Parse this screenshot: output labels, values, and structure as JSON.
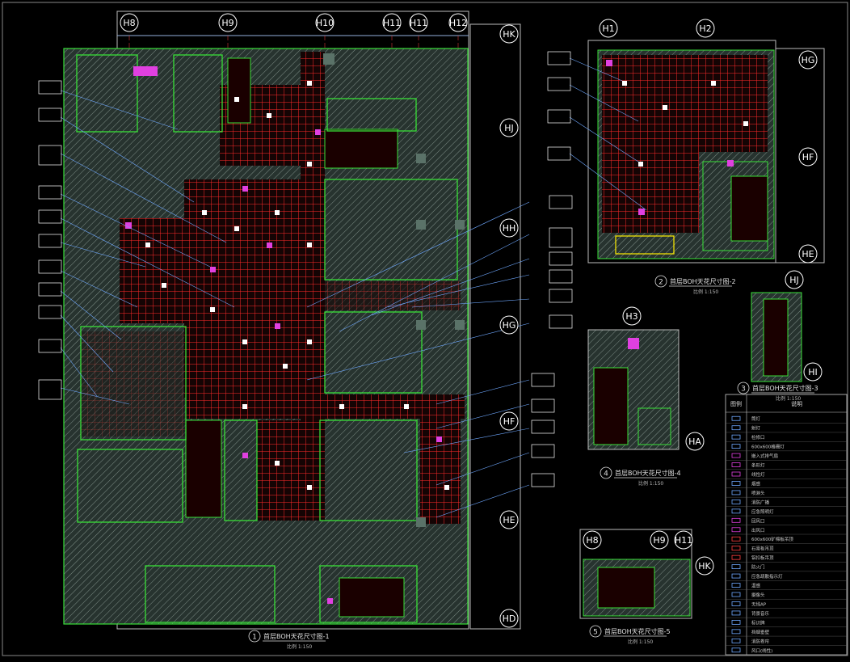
{
  "colors": {
    "background": "#000000",
    "wall_fill": "#3a4a44",
    "hatch": "#7f8f88",
    "ceiling_grid": "#ff2a2a",
    "room_outline": "#38e038",
    "fixture": "#e040e0",
    "light": "#ffffff",
    "annotation": "#ffffff",
    "leader": "#6fa8ff",
    "axis_line": "#ff4040",
    "title": "#e0e0e0"
  },
  "axes": {
    "plan1_top": [
      "H8",
      "H9",
      "H10",
      "H11",
      "H11",
      "H12"
    ],
    "plan1_right": [
      "HK",
      "HJ",
      "HH",
      "HG",
      "HF",
      "HE",
      "HD"
    ],
    "plan2_top": [
      "H1",
      "H2"
    ],
    "plan2_right": [
      "HG",
      "HF",
      "HE"
    ],
    "plan3_marks": [
      "HJ",
      "HI"
    ],
    "plan4_marks": [
      "H3",
      "HA"
    ],
    "plan5_top": [
      "H8",
      "H9",
      "H11"
    ],
    "plan5_right": [
      "HK"
    ]
  },
  "titles": [
    {
      "num": "1",
      "text": "首层BOH天花尺寸图-1",
      "scale": "比例 1:150"
    },
    {
      "num": "2",
      "text": "首层BOH天花尺寸图-2",
      "scale": "比例 1:150"
    },
    {
      "num": "3",
      "text": "首层BOH天花尺寸图-3",
      "scale": "比例 1:150"
    },
    {
      "num": "4",
      "text": "首层BOH天花尺寸图-4",
      "scale": "比例 1:150"
    },
    {
      "num": "5",
      "text": "首层BOH天花尺寸图-5",
      "scale": "比例 1:150"
    }
  ],
  "legend": {
    "header_symbol": "图例",
    "header_desc": "说明",
    "rows": [
      "筒灯",
      "射灯",
      "检修口",
      "600x600格栅灯",
      "嵌入式排气扇",
      "条形灯",
      "线性灯",
      "烟感",
      "喷淋头",
      "消防广播",
      "应急照明灯",
      "回风口",
      "出风口",
      "600x600矿棉板吊顶",
      "石膏板吊顶",
      "铝扣板吊顶",
      "防火门",
      "应急疏散指示灯",
      "温感",
      "摄像头",
      "无线AP",
      "背景音乐",
      "标识牌",
      "挡烟垂壁",
      "消防卷帘",
      "风口(线性)"
    ]
  }
}
